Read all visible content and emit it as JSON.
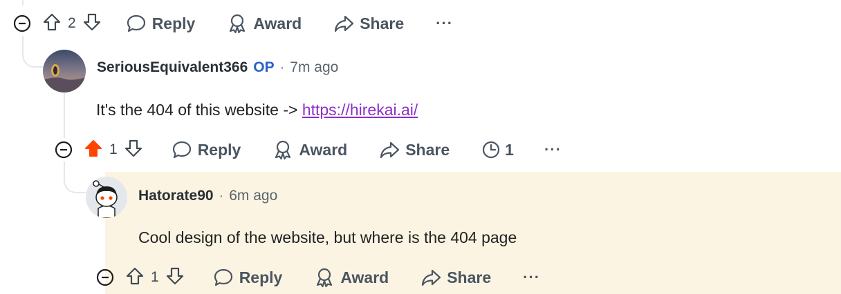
{
  "colors": {
    "highlight_bg": "#fcf4e3",
    "op_blue": "#2b62c2",
    "link_purple": "#8b2fc9",
    "upvote_orange": "#ff4500"
  },
  "comment0": {
    "vote_count": "2",
    "actions": {
      "reply": "Reply",
      "award": "Award",
      "share": "Share",
      "more": "···"
    }
  },
  "comment1": {
    "username": "SeriousEquivalent366",
    "op_badge": "OP",
    "separator": "·",
    "time": "7m ago",
    "text": "It's the 404 of this website -> ",
    "link_text": "https://hirekai.ai/",
    "vote_count": "1",
    "upvoted": true,
    "actions": {
      "reply": "Reply",
      "award": "Award",
      "share": "Share",
      "history_count": "1",
      "more": "···"
    }
  },
  "comment2": {
    "username": "Hatorate90",
    "separator": "·",
    "time": "6m ago",
    "text": "Cool design of the website, but where is the 404 page",
    "vote_count": "1",
    "actions": {
      "reply": "Reply",
      "award": "Award",
      "share": "Share",
      "more": "···"
    }
  }
}
